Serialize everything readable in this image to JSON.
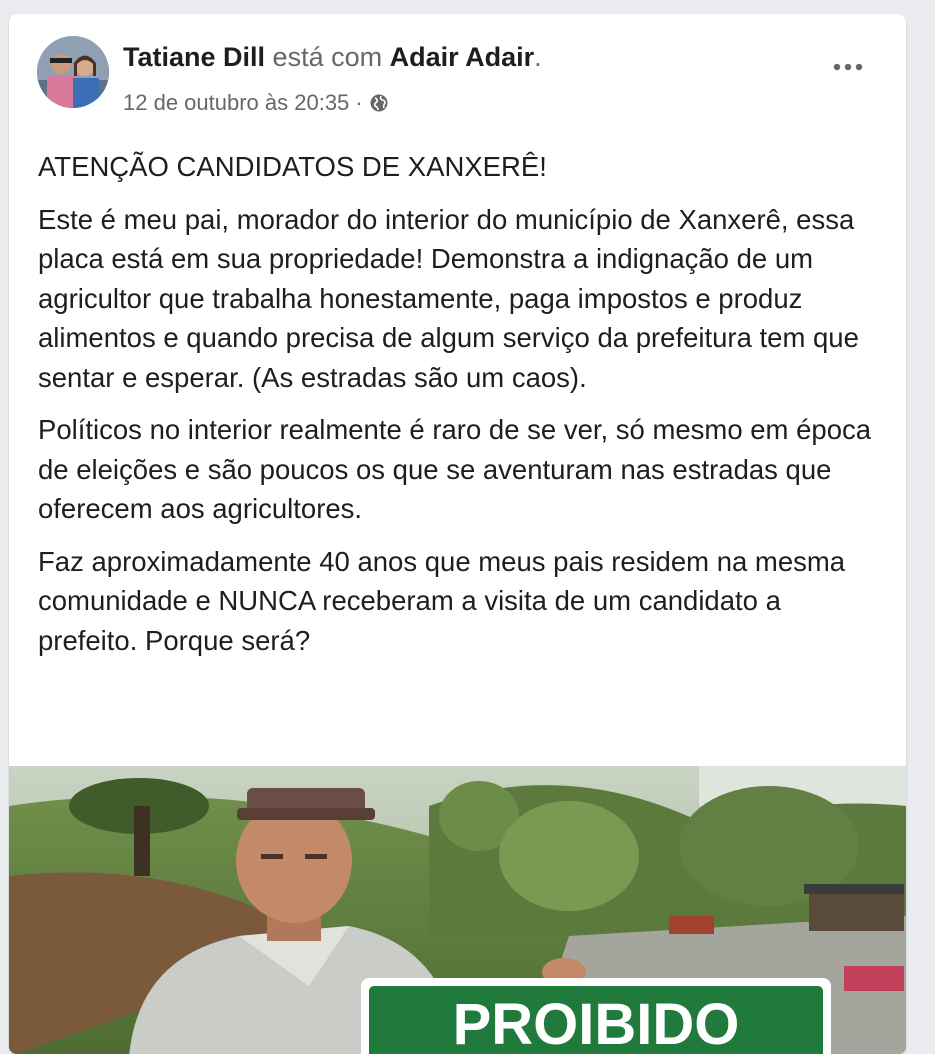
{
  "post": {
    "author": "Tatiane Dill",
    "with_text": "está com",
    "tagged": "Adair Adair",
    "period": ".",
    "timestamp": "12 de outubro às 20:35",
    "separator": "·",
    "privacy_icon": "globe-icon",
    "more_icon": "more-options-icon",
    "paragraphs": [
      "ATENÇÃO CANDIDATOS DE XANXERÊ!",
      "Este é meu pai, morador do interior do município de Xanxerê, essa placa está em sua propriedade! Demonstra a indignação de um agricultor que trabalha honestamente, paga impostos e produz alimentos e quando precisa de algum serviço da prefeitura tem que sentar e esperar. (As estradas são um caos).",
      "Políticos no interior realmente é raro de se ver, só mesmo em época de eleições e são poucos os que se aventuram nas estradas que oferecem aos agricultores.",
      "Faz aproximadamente 40 anos que meus pais residem na mesma comunidade e NUNCA receberam a visita de um candidato a prefeito. Porque será?"
    ],
    "photo": {
      "sign_text": "PROIBIDO"
    }
  },
  "colors": {
    "background": "#e9ebee",
    "card": "#ffffff",
    "text": "#1c1e21",
    "secondary": "#65676b",
    "sign_green": "#1f7a3c"
  }
}
